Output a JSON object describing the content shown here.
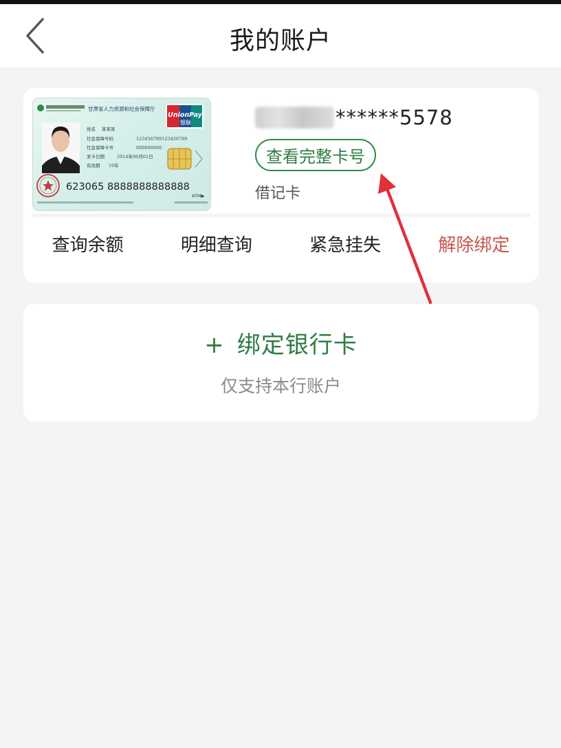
{
  "header": {
    "title": "我的账户"
  },
  "card": {
    "number_masked": "******5578",
    "view_full_label": "查看完整卡号",
    "type": "借记卡",
    "image": {
      "issuer_line": "甘肃省人力资源和社会保障厅",
      "brand": "UnionPay",
      "brand_cn": "银联",
      "number": "623065 8888888888888",
      "atm_label": "ATM▶",
      "fields": [
        {
          "label": "姓名",
          "value": "某某某"
        },
        {
          "label": "社会保障号码",
          "value": "123456789123456789"
        },
        {
          "label": "社会保障卡号",
          "value": "000000000"
        },
        {
          "label": "发卡日期",
          "value": "2014年06月01日"
        },
        {
          "label": "有效期",
          "value": "10年"
        }
      ]
    }
  },
  "actions": [
    {
      "label": "查询余额"
    },
    {
      "label": "明细查询"
    },
    {
      "label": "紧急挂失"
    },
    {
      "label": "解除绑定"
    }
  ],
  "bind": {
    "plus": "+",
    "label": "绑定银行卡",
    "subtitle": "仅支持本行账户"
  },
  "colors": {
    "accent_green": "#2e7d42",
    "danger_red": "#c8554c",
    "arrow_red": "#e0303a",
    "background": "#f4f4f4"
  }
}
